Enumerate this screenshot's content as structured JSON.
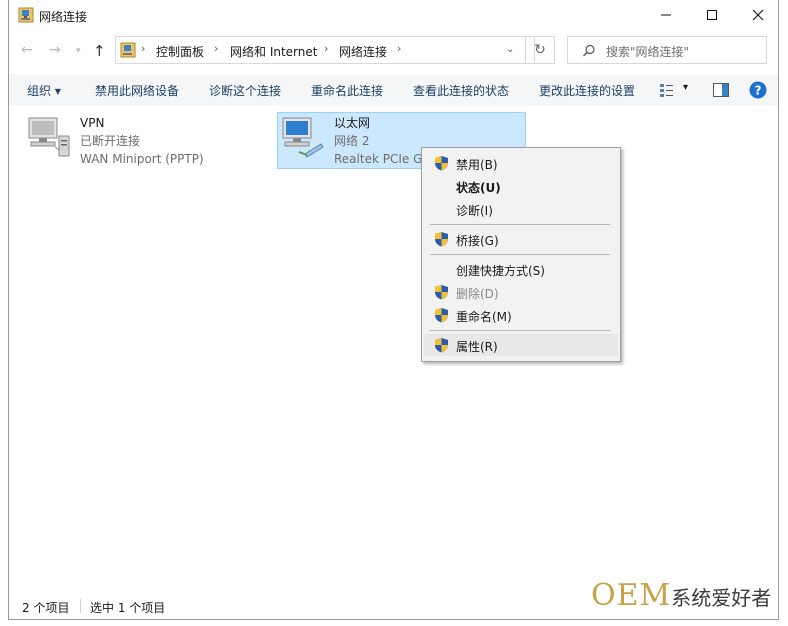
{
  "window": {
    "title": "网络连接"
  },
  "address": {
    "crumbs": [
      "控制面板",
      "网络和 Internet",
      "网络连接"
    ]
  },
  "search": {
    "placeholder": "搜索\"网络连接\""
  },
  "toolbar": {
    "items": [
      "组织 ▾",
      "禁用此网络设备",
      "诊断这个连接",
      "重命名此连接",
      "查看此连接的状态",
      "更改此连接的设置"
    ]
  },
  "connections": [
    {
      "name": "VPN",
      "status": "已断开连接",
      "device": "WAN Miniport (PPTP)"
    },
    {
      "name": "以太网",
      "status": "网络 2",
      "device": "Realtek PCIe GI"
    }
  ],
  "context_menu": {
    "items": [
      "禁用(B)",
      "状态(U)",
      "诊断(I)",
      "桥接(G)",
      "创建快捷方式(S)",
      "删除(D)",
      "重命名(M)",
      "属性(R)"
    ]
  },
  "status": {
    "count": "2 个项目",
    "selected": "选中 1 个项目"
  },
  "watermark": {
    "brand": "OEM",
    "text": "系统爱好者"
  },
  "colors": {
    "accent": "#1e3f66",
    "selection": "#cce8ff",
    "help": "#1f6fd1"
  }
}
